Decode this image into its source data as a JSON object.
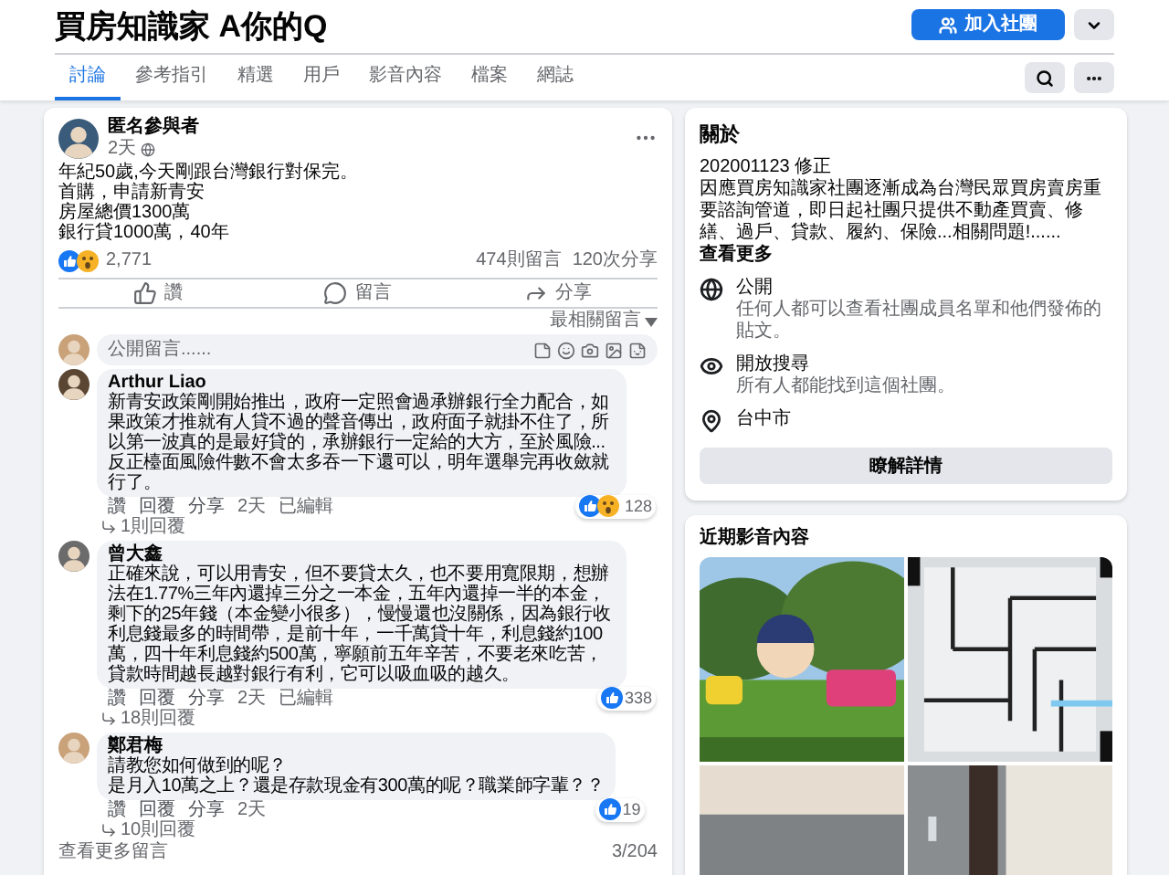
{
  "group": {
    "title": "買房知識家 A你的Q",
    "join_button": "加入社團"
  },
  "tabs": [
    {
      "label": "討論",
      "selected": true
    },
    {
      "label": "參考指引",
      "selected": false
    },
    {
      "label": "精選",
      "selected": false
    },
    {
      "label": "用戶",
      "selected": false
    },
    {
      "label": "影音內容",
      "selected": false
    },
    {
      "label": "檔案",
      "selected": false
    },
    {
      "label": "網誌",
      "selected": false
    }
  ],
  "post": {
    "author": "匿名參與者",
    "time": "2天",
    "lines": [
      "年紀50歲,今天剛跟台灣銀行對保完。",
      "首購，申請新青安",
      "房屋總價1300萬",
      "銀行貸1000萬，40年"
    ],
    "reactions": [
      {
        "kind": "like"
      },
      {
        "kind": "wow"
      }
    ],
    "reaction_count": "2,771",
    "comment_count": "474則留言",
    "share_count": "120次分享",
    "actions": [
      {
        "kind": "like",
        "label": "讚"
      },
      {
        "kind": "comment",
        "label": "留言"
      },
      {
        "kind": "share",
        "label": "分享"
      }
    ],
    "sort": "最相關留言",
    "comment_placeholder": "公開留言......"
  },
  "comments": [
    {
      "author": "Arthur Liao",
      "lines": [
        "新青安政策剛開始推出，政府一定照會過承辦銀行全力配合，如果政策才推就有人貸不過的聲音傳出，政府面子就掛不住了，所以第一波真的是最好貸的，承辦銀行一定給的大方，至於風險...反正檯面風險件數不會太多吞一下還可以，明年選舉完再收斂就行了。"
      ],
      "actions": [
        {
          "kind": "link",
          "label": "讚"
        },
        {
          "kind": "link",
          "label": "回覆"
        },
        {
          "kind": "link",
          "label": "分享"
        },
        {
          "kind": "text",
          "label": "2天"
        },
        {
          "kind": "text",
          "label": "已編輯"
        }
      ],
      "reactions": [
        {
          "kind": "like"
        },
        {
          "kind": "wow"
        }
      ],
      "reaction_count": "128",
      "replies": "1則回覆"
    },
    {
      "author": "曾大鑫",
      "lines": [
        "正確來說，可以用青安，但不要貸太久，也不要用寬限期，想辦法在1.77%三年內還掉三分之一本金，五年內還掉一半的本金，剩下的25年錢（本金變小很多），慢慢還也沒關係，因為銀行收利息錢最多的時間帶，是前十年，一千萬貸十年，利息錢約100萬，四十年利息錢約500萬，寧願前五年辛苦，不要老來吃苦，貸款時間越長越對銀行有利，它可以吸血吸的越久。"
      ],
      "actions": [
        {
          "kind": "link",
          "label": "讚"
        },
        {
          "kind": "link",
          "label": "回覆"
        },
        {
          "kind": "link",
          "label": "分享"
        },
        {
          "kind": "text",
          "label": "2天"
        },
        {
          "kind": "text",
          "label": "已編輯"
        }
      ],
      "reactions": [
        {
          "kind": "like"
        }
      ],
      "reaction_count": "338",
      "replies": "18則回覆"
    },
    {
      "author": "鄭君梅",
      "lines": [
        "請教您如何做到的呢？",
        "是月入10萬之上？還是存款現金有300萬的呢？職業師字輩？？"
      ],
      "actions": [
        {
          "kind": "link",
          "label": "讚"
        },
        {
          "kind": "link",
          "label": "回覆"
        },
        {
          "kind": "link",
          "label": "分享"
        },
        {
          "kind": "text",
          "label": "2天"
        }
      ],
      "reactions": [
        {
          "kind": "like"
        }
      ],
      "reaction_count": "19",
      "replies": "10則回覆"
    }
  ],
  "more_comments": "查看更多留言",
  "comment_page": "3/204",
  "about": {
    "title": "關於",
    "date": "202001123 修正",
    "text": "因應買房知識家社團逐漸成為台灣民眾買房賣房重要諮詢管道，即日起社團只提供不動產買賣、修繕、過戶、貸款、履約、保險...相關問題!......",
    "see_more": "查看更多",
    "items": [
      {
        "kind": "privacy",
        "title": "公開",
        "text": "任何人都可以查看社團成員名單和他們發佈的貼文。"
      },
      {
        "kind": "visibility",
        "title": "開放搜尋",
        "text": "所有人都能找到這個社團。"
      },
      {
        "kind": "location",
        "title": "台中市"
      }
    ],
    "button": "瞭解詳情"
  },
  "media": {
    "title": "近期影音內容"
  }
}
